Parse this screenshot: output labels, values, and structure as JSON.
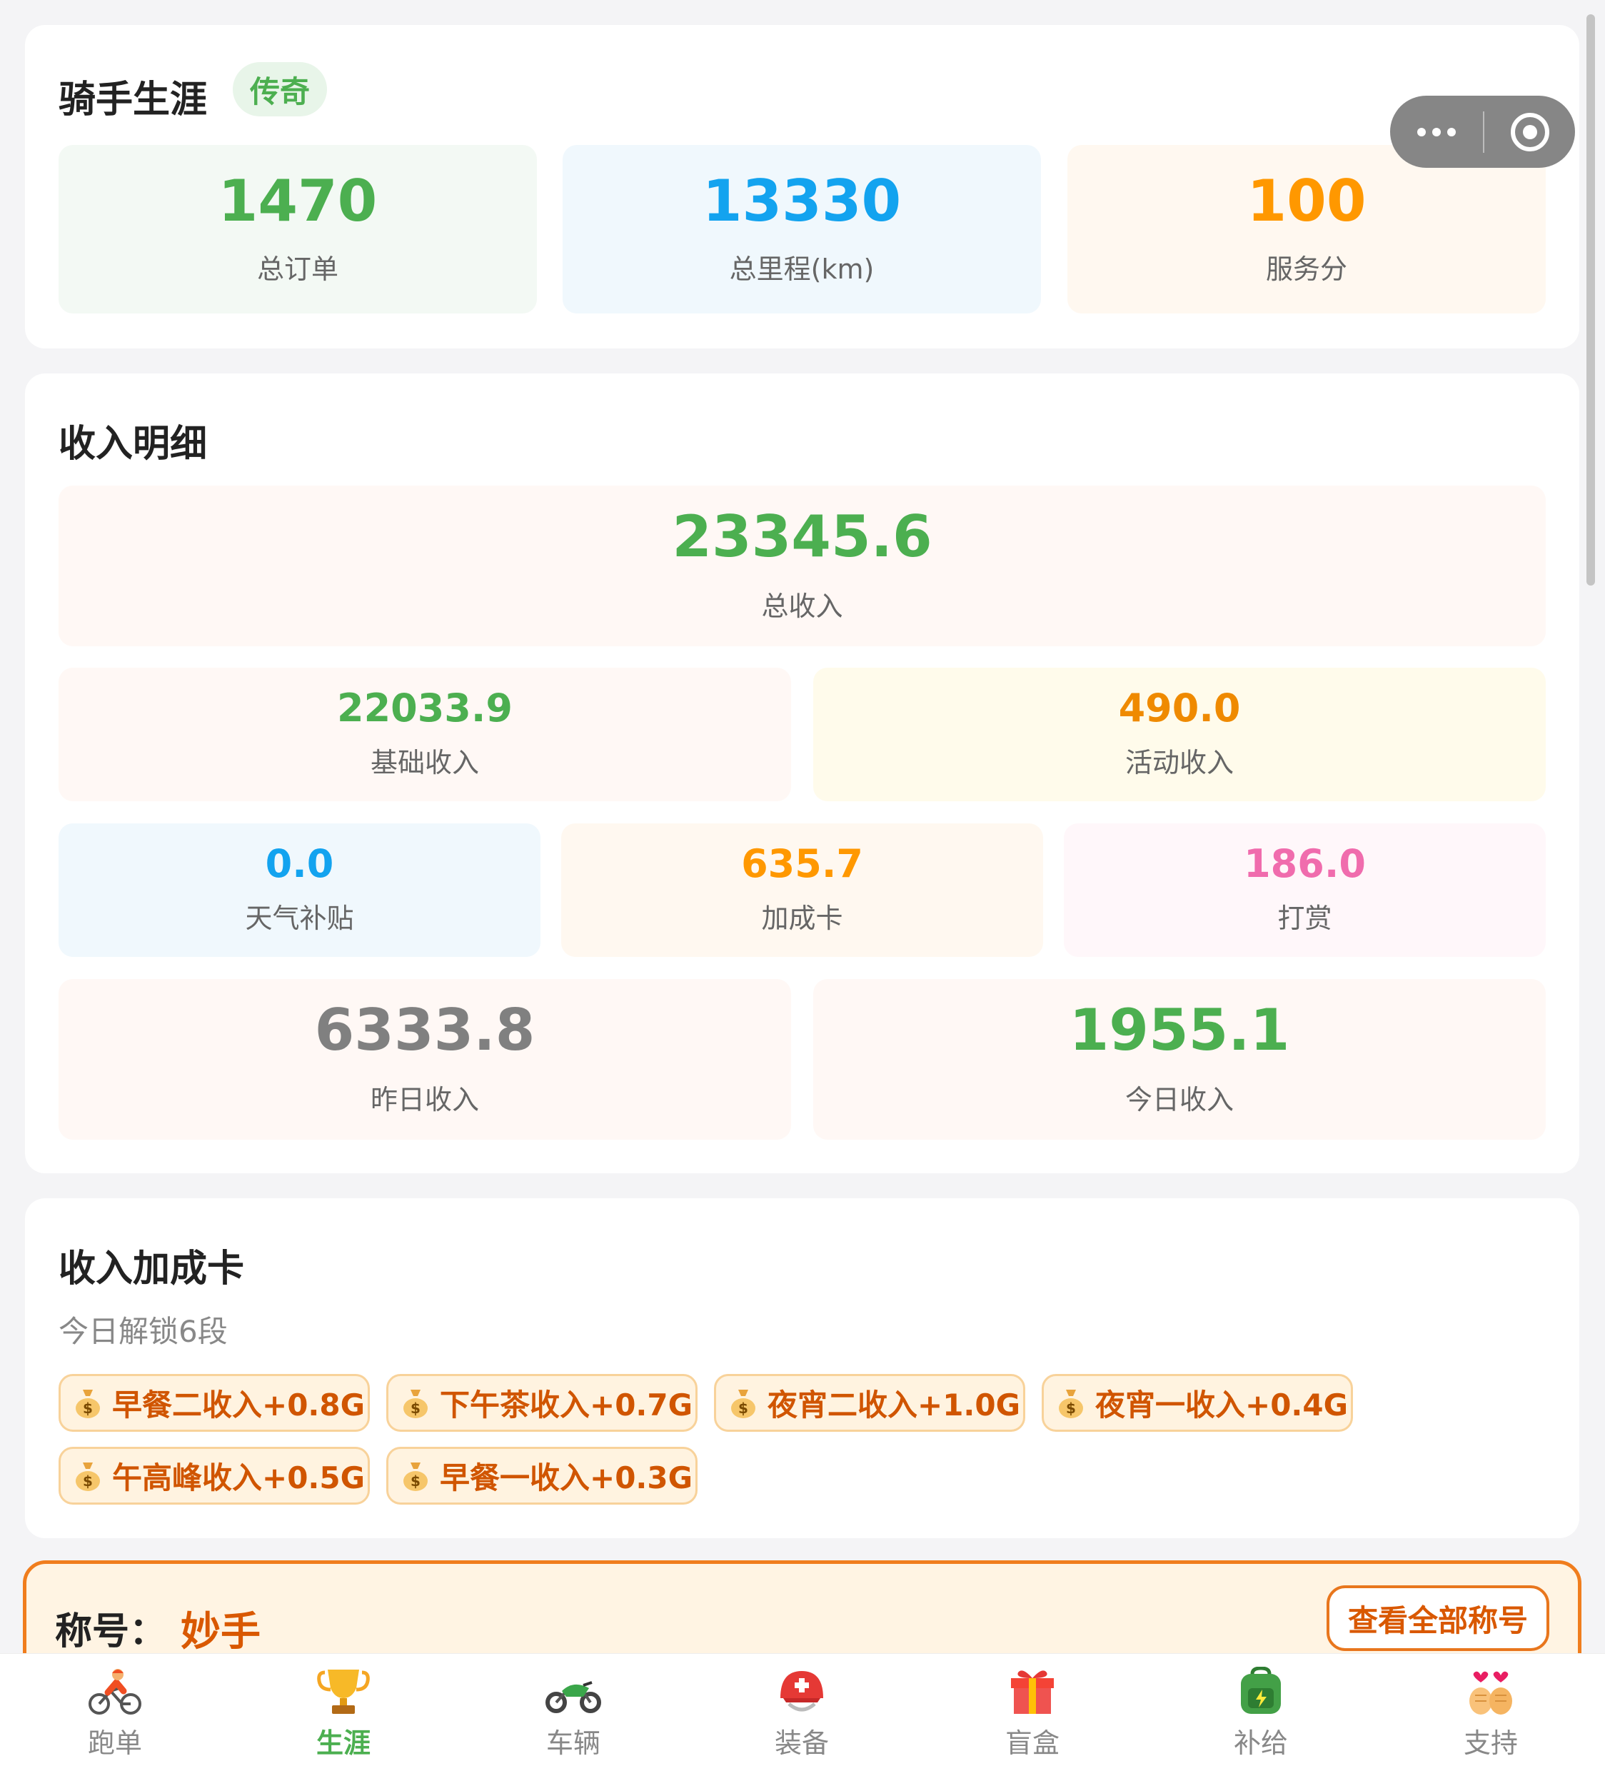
{
  "career": {
    "title": "骑手生涯",
    "badge": "传奇",
    "stats": [
      {
        "value": "1470",
        "label": "总订单",
        "color": "#4caf50"
      },
      {
        "value": "13330",
        "label": "总里程(km)",
        "color": "#13a3ef"
      },
      {
        "value": "100",
        "label": "服务分",
        "color": "#ff9800"
      }
    ]
  },
  "income": {
    "title": "收入明细",
    "total": {
      "value": "23345.6",
      "label": "总收入"
    },
    "base": {
      "value": "22033.9",
      "label": "基础收入"
    },
    "activity": {
      "value": "490.0",
      "label": "活动收入"
    },
    "weather": {
      "value": "0.0",
      "label": "天气补贴"
    },
    "bonus_card": {
      "value": "635.7",
      "label": "加成卡"
    },
    "tip": {
      "value": "186.0",
      "label": "打赏"
    },
    "yesterday": {
      "value": "6333.8",
      "label": "昨日收入"
    },
    "today": {
      "value": "1955.1",
      "label": "今日收入"
    }
  },
  "bonus": {
    "title": "收入加成卡",
    "subtitle": "今日解锁6段",
    "chips": [
      "早餐二收入+0.8G",
      "下午茶收入+0.7G",
      "夜宵二收入+1.0G",
      "夜宵一收入+0.4G",
      "午高峰收入+0.5G",
      "早餐一收入+0.3G"
    ]
  },
  "rank_title": {
    "label": "称号：",
    "value": "妙手",
    "button": "查看全部称号"
  },
  "tabs": [
    {
      "label": "跑单",
      "icon": "cyclist-icon",
      "active": false
    },
    {
      "label": "生涯",
      "icon": "trophy-icon",
      "active": true
    },
    {
      "label": "车辆",
      "icon": "motorcycle-icon",
      "active": false
    },
    {
      "label": "装备",
      "icon": "helmet-icon",
      "active": false
    },
    {
      "label": "盲盒",
      "icon": "gift-icon",
      "active": false
    },
    {
      "label": "补给",
      "icon": "backpack-icon",
      "active": false
    },
    {
      "label": "支持",
      "icon": "heart-hands-icon",
      "active": false
    }
  ],
  "colors": {
    "green": "#4caf50",
    "blue": "#13a3ef",
    "orange": "#ff9800",
    "pink": "#f06cad",
    "gray": "#808080",
    "accent": "#f07d1d"
  }
}
